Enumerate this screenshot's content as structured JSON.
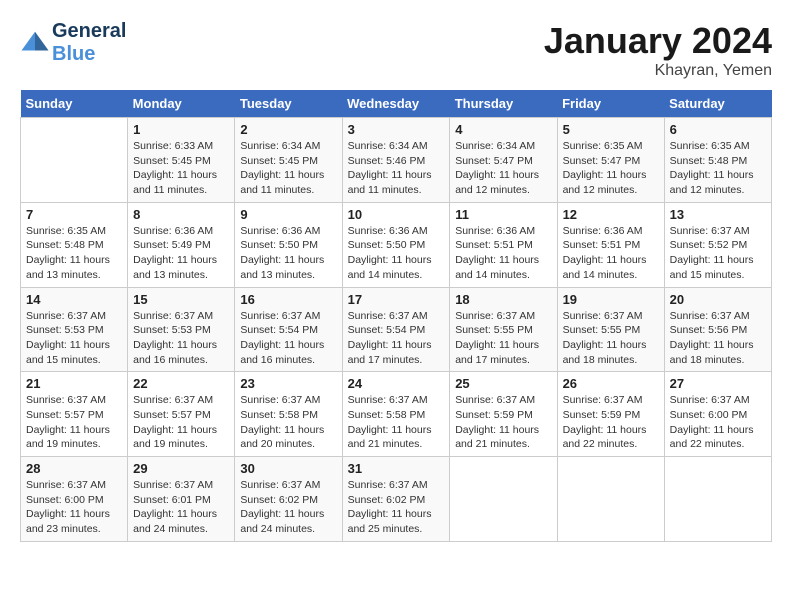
{
  "header": {
    "logo_line1": "General",
    "logo_line2": "Blue",
    "month_title": "January 2024",
    "location": "Khayran, Yemen"
  },
  "weekdays": [
    "Sunday",
    "Monday",
    "Tuesday",
    "Wednesday",
    "Thursday",
    "Friday",
    "Saturday"
  ],
  "weeks": [
    [
      {
        "num": "",
        "sunrise": "",
        "sunset": "",
        "daylight": ""
      },
      {
        "num": "1",
        "sunrise": "Sunrise: 6:33 AM",
        "sunset": "Sunset: 5:45 PM",
        "daylight": "Daylight: 11 hours and 11 minutes."
      },
      {
        "num": "2",
        "sunrise": "Sunrise: 6:34 AM",
        "sunset": "Sunset: 5:45 PM",
        "daylight": "Daylight: 11 hours and 11 minutes."
      },
      {
        "num": "3",
        "sunrise": "Sunrise: 6:34 AM",
        "sunset": "Sunset: 5:46 PM",
        "daylight": "Daylight: 11 hours and 11 minutes."
      },
      {
        "num": "4",
        "sunrise": "Sunrise: 6:34 AM",
        "sunset": "Sunset: 5:47 PM",
        "daylight": "Daylight: 11 hours and 12 minutes."
      },
      {
        "num": "5",
        "sunrise": "Sunrise: 6:35 AM",
        "sunset": "Sunset: 5:47 PM",
        "daylight": "Daylight: 11 hours and 12 minutes."
      },
      {
        "num": "6",
        "sunrise": "Sunrise: 6:35 AM",
        "sunset": "Sunset: 5:48 PM",
        "daylight": "Daylight: 11 hours and 12 minutes."
      }
    ],
    [
      {
        "num": "7",
        "sunrise": "Sunrise: 6:35 AM",
        "sunset": "Sunset: 5:48 PM",
        "daylight": "Daylight: 11 hours and 13 minutes."
      },
      {
        "num": "8",
        "sunrise": "Sunrise: 6:36 AM",
        "sunset": "Sunset: 5:49 PM",
        "daylight": "Daylight: 11 hours and 13 minutes."
      },
      {
        "num": "9",
        "sunrise": "Sunrise: 6:36 AM",
        "sunset": "Sunset: 5:50 PM",
        "daylight": "Daylight: 11 hours and 13 minutes."
      },
      {
        "num": "10",
        "sunrise": "Sunrise: 6:36 AM",
        "sunset": "Sunset: 5:50 PM",
        "daylight": "Daylight: 11 hours and 14 minutes."
      },
      {
        "num": "11",
        "sunrise": "Sunrise: 6:36 AM",
        "sunset": "Sunset: 5:51 PM",
        "daylight": "Daylight: 11 hours and 14 minutes."
      },
      {
        "num": "12",
        "sunrise": "Sunrise: 6:36 AM",
        "sunset": "Sunset: 5:51 PM",
        "daylight": "Daylight: 11 hours and 14 minutes."
      },
      {
        "num": "13",
        "sunrise": "Sunrise: 6:37 AM",
        "sunset": "Sunset: 5:52 PM",
        "daylight": "Daylight: 11 hours and 15 minutes."
      }
    ],
    [
      {
        "num": "14",
        "sunrise": "Sunrise: 6:37 AM",
        "sunset": "Sunset: 5:53 PM",
        "daylight": "Daylight: 11 hours and 15 minutes."
      },
      {
        "num": "15",
        "sunrise": "Sunrise: 6:37 AM",
        "sunset": "Sunset: 5:53 PM",
        "daylight": "Daylight: 11 hours and 16 minutes."
      },
      {
        "num": "16",
        "sunrise": "Sunrise: 6:37 AM",
        "sunset": "Sunset: 5:54 PM",
        "daylight": "Daylight: 11 hours and 16 minutes."
      },
      {
        "num": "17",
        "sunrise": "Sunrise: 6:37 AM",
        "sunset": "Sunset: 5:54 PM",
        "daylight": "Daylight: 11 hours and 17 minutes."
      },
      {
        "num": "18",
        "sunrise": "Sunrise: 6:37 AM",
        "sunset": "Sunset: 5:55 PM",
        "daylight": "Daylight: 11 hours and 17 minutes."
      },
      {
        "num": "19",
        "sunrise": "Sunrise: 6:37 AM",
        "sunset": "Sunset: 5:55 PM",
        "daylight": "Daylight: 11 hours and 18 minutes."
      },
      {
        "num": "20",
        "sunrise": "Sunrise: 6:37 AM",
        "sunset": "Sunset: 5:56 PM",
        "daylight": "Daylight: 11 hours and 18 minutes."
      }
    ],
    [
      {
        "num": "21",
        "sunrise": "Sunrise: 6:37 AM",
        "sunset": "Sunset: 5:57 PM",
        "daylight": "Daylight: 11 hours and 19 minutes."
      },
      {
        "num": "22",
        "sunrise": "Sunrise: 6:37 AM",
        "sunset": "Sunset: 5:57 PM",
        "daylight": "Daylight: 11 hours and 19 minutes."
      },
      {
        "num": "23",
        "sunrise": "Sunrise: 6:37 AM",
        "sunset": "Sunset: 5:58 PM",
        "daylight": "Daylight: 11 hours and 20 minutes."
      },
      {
        "num": "24",
        "sunrise": "Sunrise: 6:37 AM",
        "sunset": "Sunset: 5:58 PM",
        "daylight": "Daylight: 11 hours and 21 minutes."
      },
      {
        "num": "25",
        "sunrise": "Sunrise: 6:37 AM",
        "sunset": "Sunset: 5:59 PM",
        "daylight": "Daylight: 11 hours and 21 minutes."
      },
      {
        "num": "26",
        "sunrise": "Sunrise: 6:37 AM",
        "sunset": "Sunset: 5:59 PM",
        "daylight": "Daylight: 11 hours and 22 minutes."
      },
      {
        "num": "27",
        "sunrise": "Sunrise: 6:37 AM",
        "sunset": "Sunset: 6:00 PM",
        "daylight": "Daylight: 11 hours and 22 minutes."
      }
    ],
    [
      {
        "num": "28",
        "sunrise": "Sunrise: 6:37 AM",
        "sunset": "Sunset: 6:00 PM",
        "daylight": "Daylight: 11 hours and 23 minutes."
      },
      {
        "num": "29",
        "sunrise": "Sunrise: 6:37 AM",
        "sunset": "Sunset: 6:01 PM",
        "daylight": "Daylight: 11 hours and 24 minutes."
      },
      {
        "num": "30",
        "sunrise": "Sunrise: 6:37 AM",
        "sunset": "Sunset: 6:02 PM",
        "daylight": "Daylight: 11 hours and 24 minutes."
      },
      {
        "num": "31",
        "sunrise": "Sunrise: 6:37 AM",
        "sunset": "Sunset: 6:02 PM",
        "daylight": "Daylight: 11 hours and 25 minutes."
      },
      {
        "num": "",
        "sunrise": "",
        "sunset": "",
        "daylight": ""
      },
      {
        "num": "",
        "sunrise": "",
        "sunset": "",
        "daylight": ""
      },
      {
        "num": "",
        "sunrise": "",
        "sunset": "",
        "daylight": ""
      }
    ]
  ]
}
